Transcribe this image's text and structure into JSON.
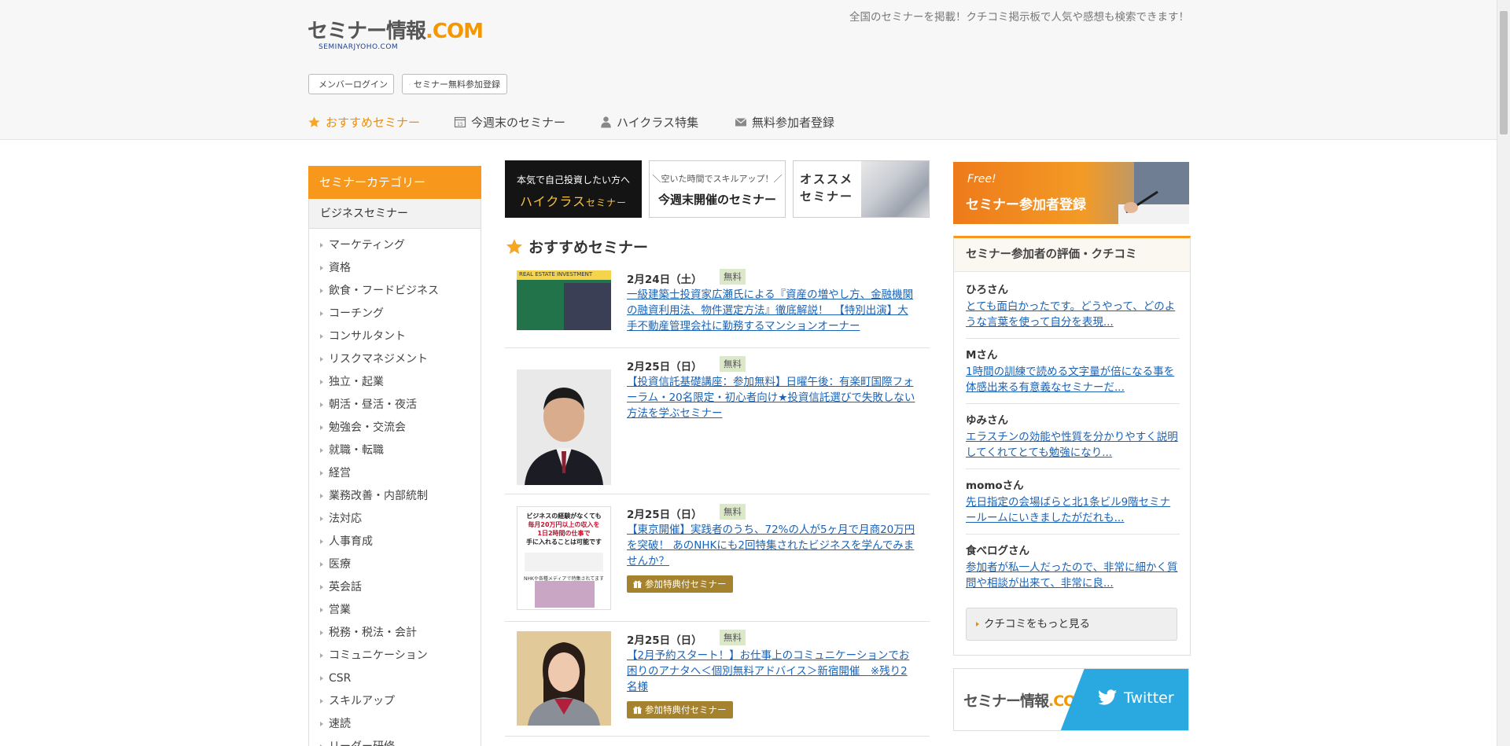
{
  "header": {
    "tagline": "全国のセミナーを掲載！クチコミ掲示板で人気や感想も検索できます！",
    "logo_main_a": "セミナー情報",
    "logo_main_b": ".COM",
    "logo_sub": "SEMINARJYOHO.COM",
    "member_login": "メンバーログイン",
    "free_register": "セミナー無料参加登録"
  },
  "nav": {
    "recommended": "おすすめセミナー",
    "weekend": "今週末のセミナー",
    "highclass": "ハイクラス特集",
    "register": "無料参加者登録"
  },
  "sidebar": {
    "title": "セミナーカテゴリー",
    "subtitle": "ビジネスセミナー",
    "items": [
      "マーケティング",
      "資格",
      "飲食・フードビジネス",
      "コーチング",
      "コンサルタント",
      "リスクマネジメント",
      "独立・起業",
      "朝活・昼活・夜活",
      "勉強会・交流会",
      "就職・転職",
      "経営",
      "業務改善・内部統制",
      "法対応",
      "人事育成",
      "医療",
      "英会話",
      "営業",
      "税務・税法・会計",
      "コミュニケーション",
      "CSR",
      "スキルアップ",
      "速読",
      "リーダー研修"
    ]
  },
  "banners": {
    "highclass_l1": "本気で自己投資したい方へ",
    "highclass_l2": "ハイクラス",
    "highclass_l2b": "セミナー",
    "weekend_l1": "＼空いた時間でスキルアップ！／",
    "weekend_l2": "今週末開催のセミナー",
    "osusume_l1": "オススメ",
    "osusume_l2": "セミナー"
  },
  "recommended": {
    "title": "おすすめセミナー",
    "entries": [
      {
        "date": "2月24日（土）",
        "free": "無料",
        "title": "一級建築士投資家広瀬氏による『資産の増やし方、金融機関の融資利用法、物件選定方法』徹底解説！　【特別出演】大手不動産管理会社に勤務するマンションオーナー",
        "thumb_text": "REAL ESTATE INVESTMENT"
      },
      {
        "date": "2月25日（日）",
        "free": "無料",
        "title": "【投資信託基礎講座：参加無料】日曜午後：有楽町国際フォーラム・20名限定・初心者向け★投資信託選びで失敗しない方法を学ぶセミナー"
      },
      {
        "date": "2月25日（日）",
        "free": "無料",
        "title": "【東京開催】実践者のうち、72%の人が5ヶ月で月商20万円を突破！ あのNHKにも2回特集されたビジネスを学んでみませんか？",
        "perk": "参加特典付セミナー",
        "thumb_l1": "ビジネスの経験がなくても",
        "thumb_l2": "毎月20万円以上の収入を",
        "thumb_l3": "1日2時間の仕事で",
        "thumb_l4": "手に入れることは可能です",
        "thumb_l5": "NHKや各種メディアで特集されてます"
      },
      {
        "date": "2月25日（日）",
        "free": "無料",
        "title": "【2月予約スタート！】お仕事上のコミュニケーションでお困りのアナタへ＜個別無料アドバイス＞新宿開催　※残り2名様",
        "perk": "参加特典付セミナー"
      }
    ]
  },
  "right": {
    "reg_free": "Free!",
    "reg_main": "セミナー参加者登録",
    "reviews_title": "セミナー参加者の評価・クチコミ",
    "reviews": [
      {
        "name": "ひろさん",
        "text": "とても面白かったです。どうやって、どのような言葉を使って自分を表現..."
      },
      {
        "name": "Mさん",
        "text": "1時間の訓練で読める文字量が倍になる事を体感出来る有意義なセミナーだ..."
      },
      {
        "name": "ゆみさん",
        "text": "エラスチンの効能や性質を分かりやすく説明してくれてとても勉強になり..."
      },
      {
        "name": "momoさん",
        "text": "先日指定の会場ばらと北1条ビル9階セミナールームにいきましたがだれも..."
      },
      {
        "name": "食べログさん",
        "text": "参加者が私一人だったので、非常に細かく質問や相談が出来て、非常に良..."
      }
    ],
    "reviews_more": "クチコミをもっと見る",
    "twitter_logo_a": "セミナー情報",
    "twitter_logo_b": ".COM",
    "twitter_label": "Twitter"
  },
  "colors": {
    "accent": "#f7971c",
    "link": "#1a63b5",
    "perk": "#a5822d",
    "twitter": "#2aa9e0"
  }
}
